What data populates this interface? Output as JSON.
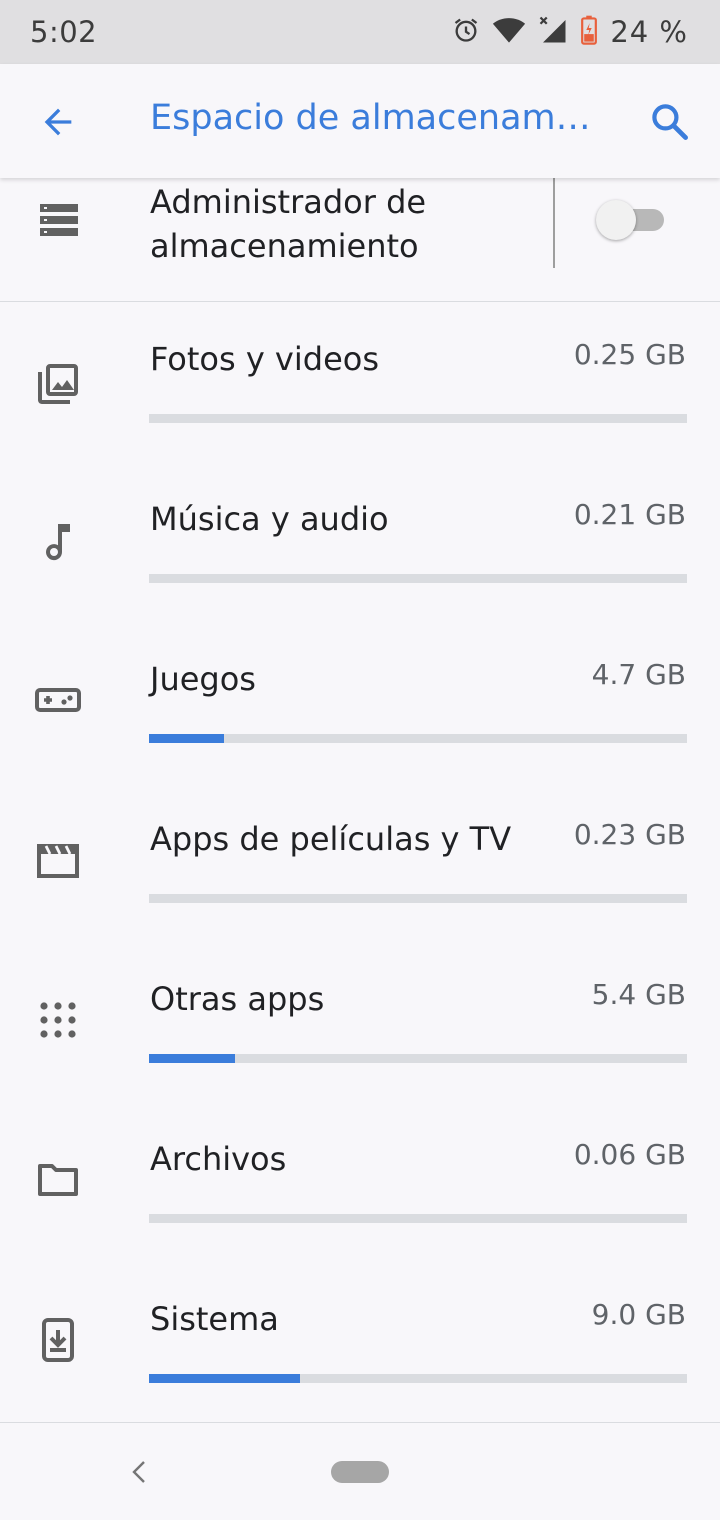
{
  "status_bar": {
    "time": "5:02",
    "battery_percent": "24 %",
    "icons": [
      "alarm-icon",
      "wifi-icon",
      "signal-icon",
      "battery-icon"
    ]
  },
  "app_bar": {
    "title": "Espacio de almacenam…",
    "back_icon": "arrow-back-icon",
    "search_icon": "search-icon"
  },
  "storage_manager": {
    "label": "Administrador de almacenamiento",
    "toggle_on": false
  },
  "categories": [
    {
      "label": "Fotos y videos",
      "size": "0.25 GB",
      "icon": "photos-icon",
      "fill_fraction": 0.0
    },
    {
      "label": "Música y audio",
      "size": "0.21 GB",
      "icon": "music-note-icon",
      "fill_fraction": 0.0
    },
    {
      "label": "Juegos",
      "size": "4.7 GB",
      "icon": "gamepad-icon",
      "fill_fraction": 0.14
    },
    {
      "label": "Apps de películas y TV",
      "size": "0.23 GB",
      "icon": "movie-icon",
      "fill_fraction": 0.0
    },
    {
      "label": "Otras apps",
      "size": "5.4 GB",
      "icon": "apps-grid-icon",
      "fill_fraction": 0.16
    },
    {
      "label": "Archivos",
      "size": "0.06 GB",
      "icon": "folder-icon",
      "fill_fraction": 0.0
    },
    {
      "label": "Sistema",
      "size": "9.0 GB",
      "icon": "system-update-icon",
      "fill_fraction": 0.28
    }
  ],
  "nav_bar": {
    "back_icon": "nav-back-icon",
    "home_icon": "home-pill-icon"
  },
  "colors": {
    "accent": "#3b7ddb",
    "background": "#f8f7fa",
    "status_bar": "#e0dfe1",
    "bar_track": "#dadce0"
  }
}
